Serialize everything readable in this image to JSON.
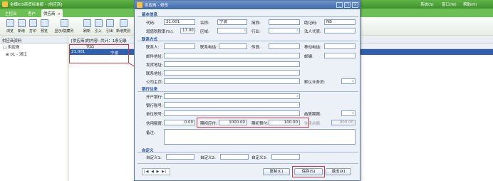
{
  "app": {
    "title": "金蝶KIS商贸标准版 - [供应商]",
    "menu": [
      "系统(S)",
      "窗口(W)",
      "帮助(H)"
    ],
    "tabs": [
      "主控台",
      "客户",
      "供应商"
    ]
  },
  "toolbar": [
    "浏览",
    "新增",
    "打印",
    "预览",
    "显示/隐藏列",
    "刷新",
    "引入",
    "引出",
    "新增类别",
    "删除类别"
  ],
  "left_pane": {
    "header": "供应商资料",
    "root": "供应商",
    "child": "01 - 浙江"
  },
  "right_pane": {
    "header": "[供应商]的内容--共计：1条记录",
    "column_code": "代码",
    "row": {
      "code": "21.001",
      "name": "宁波"
    }
  },
  "dialog": {
    "title": "供应商 - 修改",
    "basic": {
      "section": "基本信息",
      "code_label": "代码:",
      "code": "21.001",
      "name_label": "名称:",
      "name": "宁波",
      "short_label": "简称:",
      "short": "",
      "mnemonic_label": "助记码:",
      "mnemonic": "NB",
      "tax_label": "增值税税率(%):",
      "tax": "17.00",
      "region_label": "区域:",
      "region": "",
      "industry_label": "行业:",
      "industry": "",
      "legal_label": "法人代表:",
      "legal": ""
    },
    "contact": {
      "section": "联系方式",
      "person_label": "联系人:",
      "phone_label": "联系电话:",
      "fax_label": "传真:",
      "mobile_label": "移动电话:",
      "postcode_label": "邮编:",
      "mail_label": "邮件地址:",
      "ship_label": "发货地址:",
      "addr_label": "联系地址:",
      "home_label": "公司主页:",
      "sales_label": "默认业务员:"
    },
    "bank": {
      "section": "银行往来",
      "bank_label": "开户银行:",
      "account_label": "银行账号:",
      "taxno_label": "单位税号:",
      "settle_label": "结算期限:",
      "credit_label": "信用额度:",
      "credit": "0.00",
      "opening_payable_label": "期初应付:",
      "opening_payable": "1000.00",
      "opening_prepaid_label": "期初预付:",
      "opening_prepaid": "100.00",
      "days_label": "往来余额:",
      "days": "900.00",
      "note_label": "备注:"
    },
    "custom": {
      "section": "自定义",
      "c1_label": "自定义1:",
      "c2_label": "自定义2:",
      "c3_label": "自定义3:"
    },
    "buttons": {
      "copy": "复制(C)",
      "save": "保存(S)",
      "exit": "退出(X)"
    },
    "nav": "|◀ ◀ ▶ ▶|"
  },
  "colors": {
    "accent": "#3f6aa9",
    "green": "#5fb548",
    "highlight": "#d8343a",
    "selection": "#2f5fb0"
  }
}
